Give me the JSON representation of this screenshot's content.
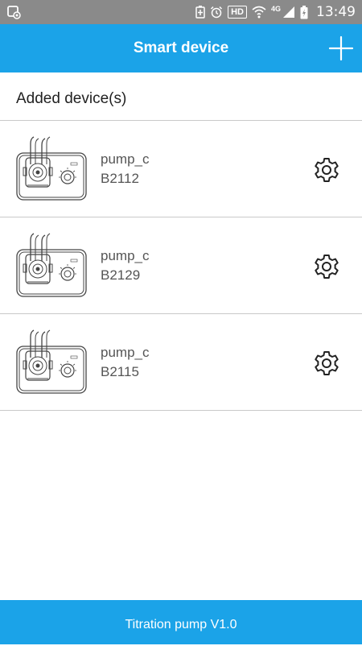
{
  "status_bar": {
    "time": "13:49",
    "hd_label": "HD",
    "network_label": "4G",
    "icons": [
      "screen-record-icon",
      "battery-saver-icon",
      "alarm-icon",
      "hd-icon",
      "wifi-icon",
      "signal-icon",
      "battery-charging-icon"
    ]
  },
  "app_bar": {
    "title": "Smart device",
    "add_icon": "plus-icon"
  },
  "section": {
    "title": "Added device(s)"
  },
  "devices": [
    {
      "name": "pump_c",
      "serial": "B2112",
      "image": "pump-illustration",
      "settings_icon": "gear-icon"
    },
    {
      "name": "pump_c",
      "serial": "B2129",
      "image": "pump-illustration",
      "settings_icon": "gear-icon"
    },
    {
      "name": "pump_c",
      "serial": "B2115",
      "image": "pump-illustration",
      "settings_icon": "gear-icon"
    }
  ],
  "footer": {
    "text": "Titration pump V1.0"
  },
  "colors": {
    "accent": "#1ba3e8",
    "status_bar": "#8a8a8a",
    "divider": "#c9c9c9",
    "device_text": "#555555"
  }
}
